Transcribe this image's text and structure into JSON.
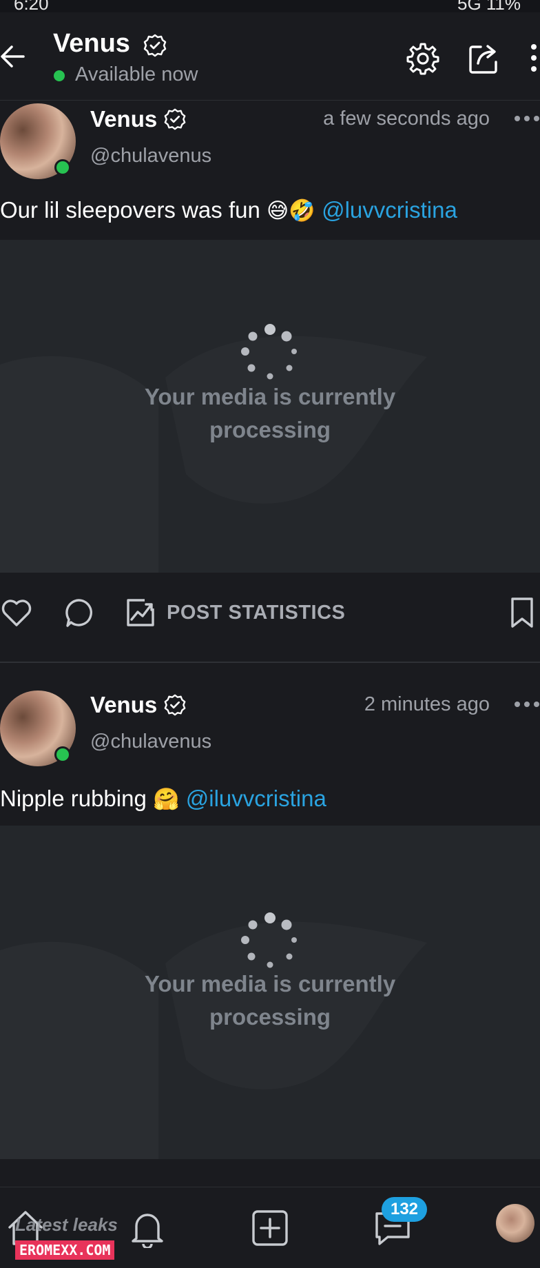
{
  "status_bar": {
    "time": "6:20",
    "right": "5G 11%"
  },
  "header": {
    "name": "Venus",
    "status": "Available now"
  },
  "posts": [
    {
      "name": "Venus",
      "handle": "@chulavenus",
      "time": "a few seconds ago",
      "text": "Our lil sleepovers was fun ",
      "emoji": "😅🤣",
      "mention": "@luvvcristina",
      "media_text_line1": "Your media is currently",
      "media_text_line2": "processing",
      "stats_label": "POST STATISTICS"
    },
    {
      "name": "Venus",
      "handle": "@chulavenus",
      "time": "2 minutes ago",
      "text": "Nipple rubbing ",
      "emoji": "🤗",
      "mention": "@iluvvcristina",
      "media_text_line1": "Your media is currently",
      "media_text_line2": "processing"
    }
  ],
  "bottom_nav": {
    "messages_badge": "132"
  },
  "watermark": {
    "top": "Latest leaks",
    "bottom": "EROMEXX.COM"
  },
  "colors": {
    "accent": "#2aa3e0",
    "online": "#27c251",
    "badge": "#1ea0e0",
    "background": "#1a1b1f",
    "media_bg": "#24272b"
  }
}
